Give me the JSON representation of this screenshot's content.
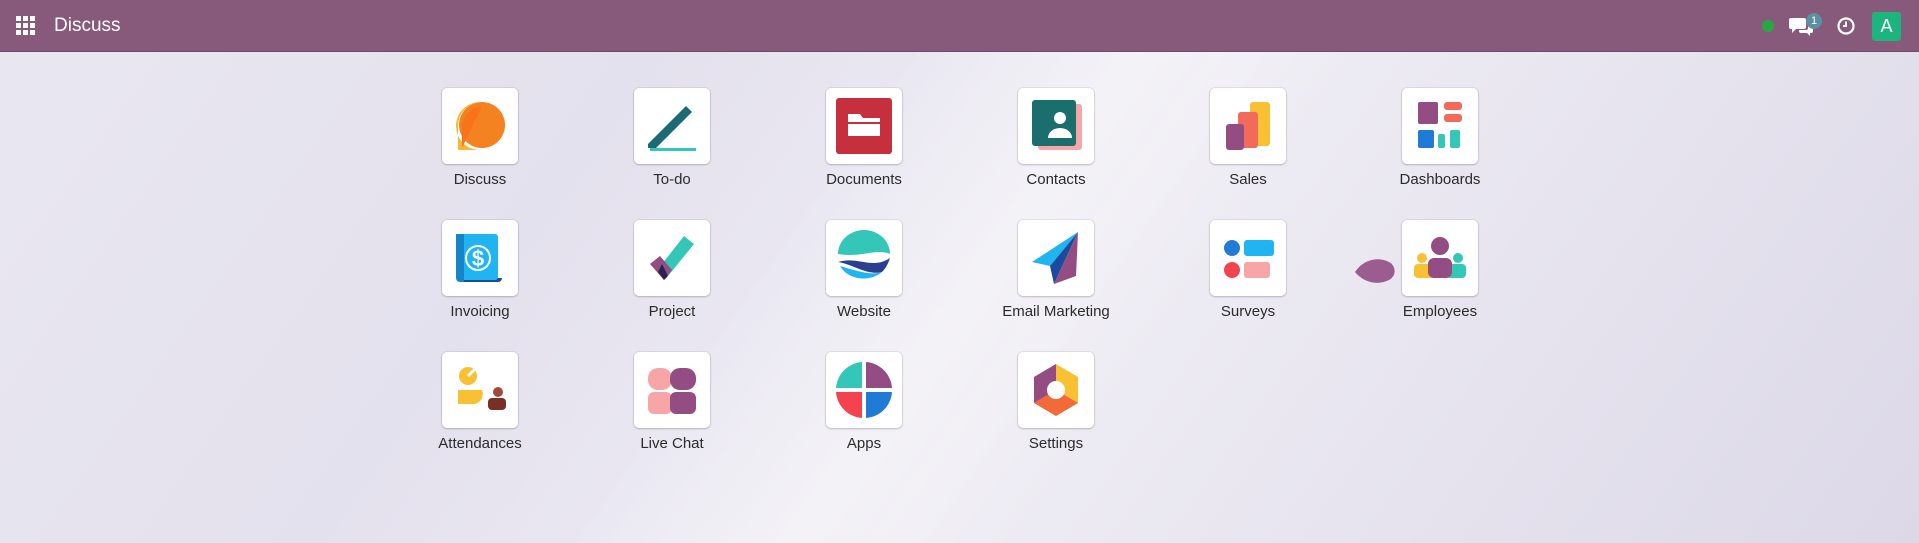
{
  "topbar": {
    "brand": "Discuss",
    "chat_badge": "1",
    "avatar_letter": "A",
    "color": "#875a7b"
  },
  "apps": [
    {
      "label": "Discuss",
      "icon": "discuss-icon"
    },
    {
      "label": "To-do",
      "icon": "todo-icon"
    },
    {
      "label": "Documents",
      "icon": "documents-icon"
    },
    {
      "label": "Contacts",
      "icon": "contacts-icon"
    },
    {
      "label": "Sales",
      "icon": "sales-icon"
    },
    {
      "label": "Dashboards",
      "icon": "dashboards-icon"
    },
    {
      "label": "Invoicing",
      "icon": "invoicing-icon"
    },
    {
      "label": "Project",
      "icon": "project-icon"
    },
    {
      "label": "Website",
      "icon": "website-icon"
    },
    {
      "label": "Email Marketing",
      "icon": "email-marketing-icon"
    },
    {
      "label": "Surveys",
      "icon": "surveys-icon"
    },
    {
      "label": "Employees",
      "icon": "employees-icon"
    },
    {
      "label": "Attendances",
      "icon": "attendances-icon"
    },
    {
      "label": "Live Chat",
      "icon": "live-chat-icon"
    },
    {
      "label": "Apps",
      "icon": "apps-icon"
    },
    {
      "label": "Settings",
      "icon": "settings-icon"
    }
  ]
}
